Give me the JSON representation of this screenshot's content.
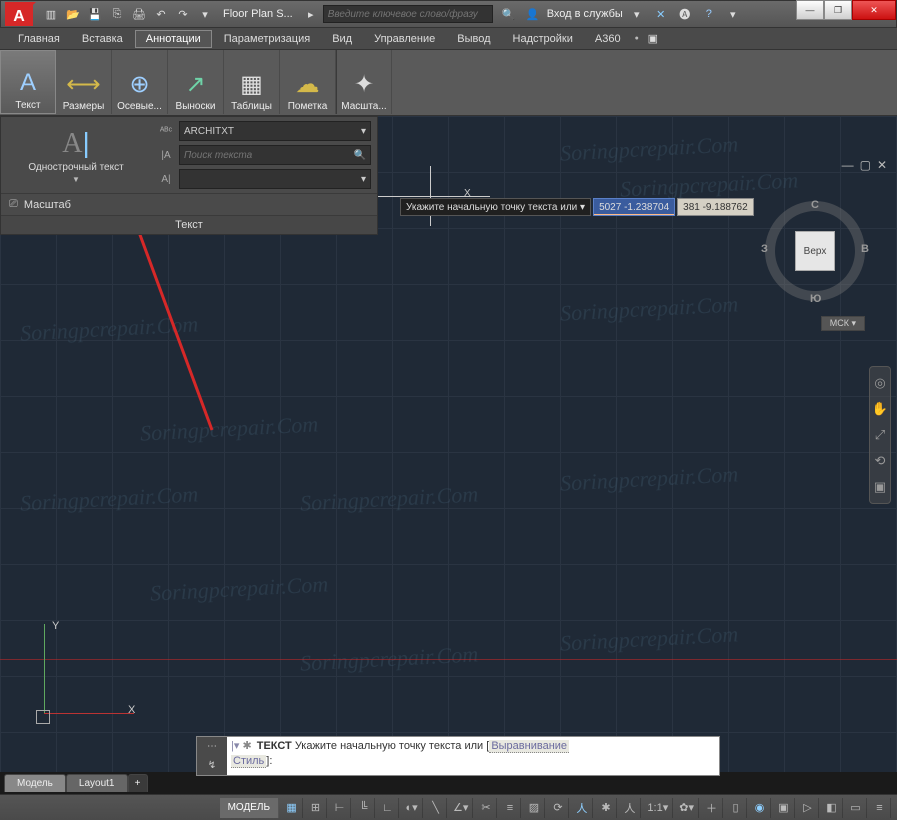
{
  "titlebar": {
    "app_initial": "A",
    "doc_title": "Floor Plan S...",
    "search_placeholder": "Введите ключевое слово/фразу",
    "login_label": "Вход в службы"
  },
  "window_controls": {
    "min": "—",
    "max": "❐",
    "close": "✕"
  },
  "menus": {
    "home": "Главная",
    "insert": "Вставка",
    "annotate": "Аннотации",
    "parametric": "Параметризация",
    "view": "Вид",
    "manage": "Управление",
    "output": "Вывод",
    "addins": "Надстройки",
    "a360": "A360"
  },
  "ribbon": {
    "text": "Текст",
    "dimensions": "Размеры",
    "centerlines": "Осевые...",
    "leaders": "Выноски",
    "tables": "Таблицы",
    "markup": "Пометка",
    "scale": "Масшта..."
  },
  "text_panel": {
    "single_line": "Однострочный текст",
    "style_selected": "ARCHITXT",
    "search_placeholder": "Поиск текста",
    "scale_label": "Масштаб",
    "panel_title": "Текст"
  },
  "dynamic_input": {
    "prompt": "Укажите начальную точку текста или",
    "coord1": "5027 -1.238704",
    "coord2": "381 -9.188762"
  },
  "viewcube": {
    "top": "Верх",
    "n": "С",
    "s": "Ю",
    "e": "В",
    "w": "З",
    "wcs": "МСК"
  },
  "axes": {
    "x": "X",
    "y": "Y"
  },
  "file_tabs": {
    "model": "Модель",
    "layout1": "Layout1",
    "add": "+"
  },
  "command": {
    "keyword": "ТЕКСТ",
    "prompt": "Укажите начальную точку текста или",
    "opt_align": "Выравнивание",
    "opt_style": "Стиль",
    "suffix": ":"
  },
  "status": {
    "model": "МОДЕЛЬ",
    "scale11": "1:1"
  },
  "watermark": "Soringpcrepair.Com"
}
